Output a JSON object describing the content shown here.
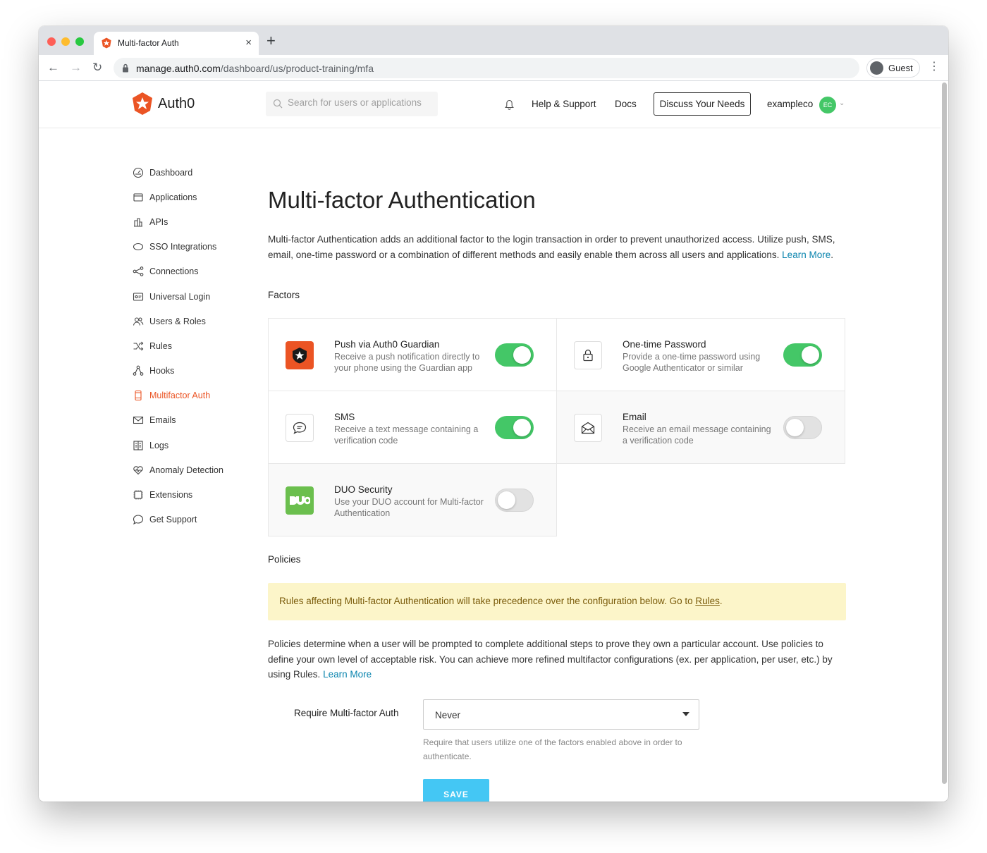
{
  "browser": {
    "tab_title": "Multi-factor Auth",
    "tab_close": "×",
    "new_tab": "+",
    "url_host": "manage.auth0.com",
    "url_path": "/dashboard/us/product-training/mfa",
    "profile": "Guest",
    "menu": "⋮",
    "back": "←",
    "forward": "→",
    "reload": "↻"
  },
  "header": {
    "logo_text": "Auth0",
    "search_placeholder": "Search for users or applications",
    "help": "Help & Support",
    "docs": "Docs",
    "discuss": "Discuss Your Needs",
    "tenant": "exampleco",
    "avatar_initials": "EC",
    "caret": "⌄"
  },
  "sidebar": {
    "items": [
      {
        "label": "Dashboard",
        "icon": "dashboard-icon"
      },
      {
        "label": "Applications",
        "icon": "applications-icon"
      },
      {
        "label": "APIs",
        "icon": "apis-icon"
      },
      {
        "label": "SSO Integrations",
        "icon": "sso-icon"
      },
      {
        "label": "Connections",
        "icon": "connections-icon"
      },
      {
        "label": "Universal Login",
        "icon": "universal-login-icon"
      },
      {
        "label": "Users & Roles",
        "icon": "users-icon"
      },
      {
        "label": "Rules",
        "icon": "rules-icon"
      },
      {
        "label": "Hooks",
        "icon": "hooks-icon"
      },
      {
        "label": "Multifactor Auth",
        "icon": "phone-icon",
        "active": true
      },
      {
        "label": "Emails",
        "icon": "emails-icon"
      },
      {
        "label": "Logs",
        "icon": "logs-icon"
      },
      {
        "label": "Anomaly Detection",
        "icon": "heart-icon"
      },
      {
        "label": "Extensions",
        "icon": "extensions-icon"
      },
      {
        "label": "Get Support",
        "icon": "chat-icon"
      }
    ]
  },
  "main": {
    "title": "Multi-factor Authentication",
    "intro": "Multi-factor Authentication adds an additional factor to the login transaction in order to prevent unauthorized access. Utilize push, SMS, email, one-time password or a combination of different methods and easily enable them across all users and applications.",
    "learn_more": "Learn More",
    "period": ".",
    "factors_heading": "Factors",
    "factors": [
      {
        "title": "Push via Auth0 Guardian",
        "desc": "Receive a push notification directly to your phone using the Guardian app",
        "enabled": true,
        "icon": "guardian-icon"
      },
      {
        "title": "One-time Password",
        "desc": "Provide a one-time password using Google Authenticator or similar",
        "enabled": true,
        "icon": "lock-icon"
      },
      {
        "title": "SMS",
        "desc": "Receive a text message containing a verification code",
        "enabled": true,
        "icon": "sms-icon"
      },
      {
        "title": "Email",
        "desc": "Receive an email message containing a verification code",
        "enabled": false,
        "icon": "email-icon"
      },
      {
        "title": "DUO Security",
        "desc": "Use your DUO account for Multi-factor Authentication",
        "enabled": false,
        "icon": "duo-icon"
      }
    ],
    "policies_heading": "Policies",
    "alert_text": "Rules affecting Multi-factor Authentication will take precedence over the configuration below. Go to ",
    "alert_link": "Rules",
    "policy_text": "Policies determine when a user will be prompted to complete additional steps to prove they own a particular account. Use policies to define your own level of acceptable risk. You can achieve more refined multifactor configurations (ex. per application, per user, etc.) by using Rules.",
    "require_label": "Require Multi-factor Auth",
    "require_value": "Never",
    "require_help": "Require that users utilize one of the factors enabled above in order to authenticate.",
    "save": "SAVE"
  },
  "colors": {
    "accent": "#eb5424",
    "toggle_on": "#44c767",
    "link": "#0a84ae",
    "save": "#44c7f4",
    "alert_bg": "#fcf5c9"
  }
}
